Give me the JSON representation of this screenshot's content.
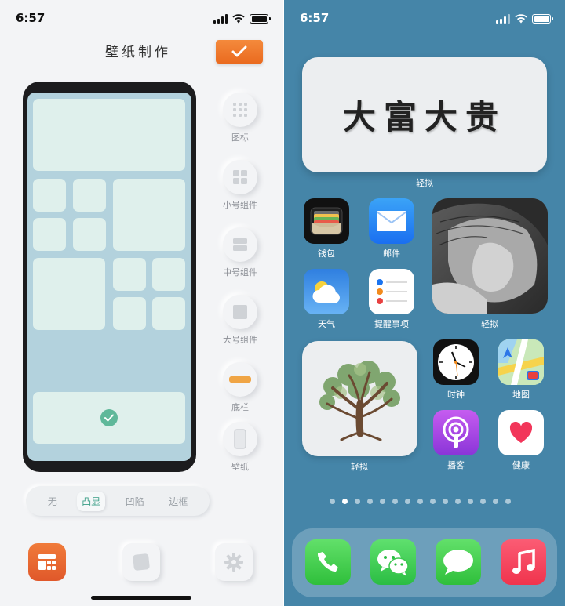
{
  "left_screen": {
    "status": {
      "time": "6:57"
    },
    "title": "壁纸制作",
    "tools": [
      {
        "label": "图标",
        "icon": "grid-icon"
      },
      {
        "label": "小号组件",
        "icon": "small-widget-icon"
      },
      {
        "label": "中号组件",
        "icon": "medium-widget-icon"
      },
      {
        "label": "大号组件",
        "icon": "large-widget-icon"
      },
      {
        "label": "底栏",
        "icon": "dock-bar-icon"
      },
      {
        "label": "壁纸",
        "icon": "wallpaper-icon"
      }
    ],
    "style_segments": [
      {
        "label": "无",
        "active": false
      },
      {
        "label": "凸显",
        "active": true
      },
      {
        "label": "凹陷",
        "active": false
      },
      {
        "label": "边框",
        "active": false
      }
    ],
    "tabs": [
      {
        "icon": "layout-icon",
        "active": true
      },
      {
        "icon": "square-icon",
        "active": false
      },
      {
        "icon": "gear-icon",
        "active": false
      }
    ],
    "colors": {
      "accent": "#ea6a1f",
      "check": "#5fb89a",
      "mock_bg": "#b3d2dd",
      "cell": "#dff0ec"
    }
  },
  "right_screen": {
    "status": {
      "time": "6:57"
    },
    "big_widget": {
      "text": "大富大贵",
      "label": "轻拟"
    },
    "apps": [
      {
        "name": "钱包",
        "icon": "wallet-icon"
      },
      {
        "name": "邮件",
        "icon": "mail-icon"
      },
      {
        "name": "天气",
        "icon": "weather-icon"
      },
      {
        "name": "提醒事项",
        "icon": "reminders-icon"
      },
      {
        "name": "时钟",
        "icon": "clock-icon"
      },
      {
        "name": "地图",
        "icon": "maps-icon"
      },
      {
        "name": "播客",
        "icon": "podcasts-icon"
      },
      {
        "name": "健康",
        "icon": "health-icon"
      }
    ],
    "photo_widget": {
      "label": "轻拟"
    },
    "tree_widget": {
      "label": "轻拟"
    },
    "page_dots": {
      "count": 15,
      "current_index": 1
    },
    "dock": [
      {
        "icon": "phone-icon"
      },
      {
        "icon": "wechat-icon"
      },
      {
        "icon": "messages-icon"
      },
      {
        "icon": "music-icon"
      }
    ],
    "colors": {
      "wallpaper": "#4585a8"
    }
  }
}
